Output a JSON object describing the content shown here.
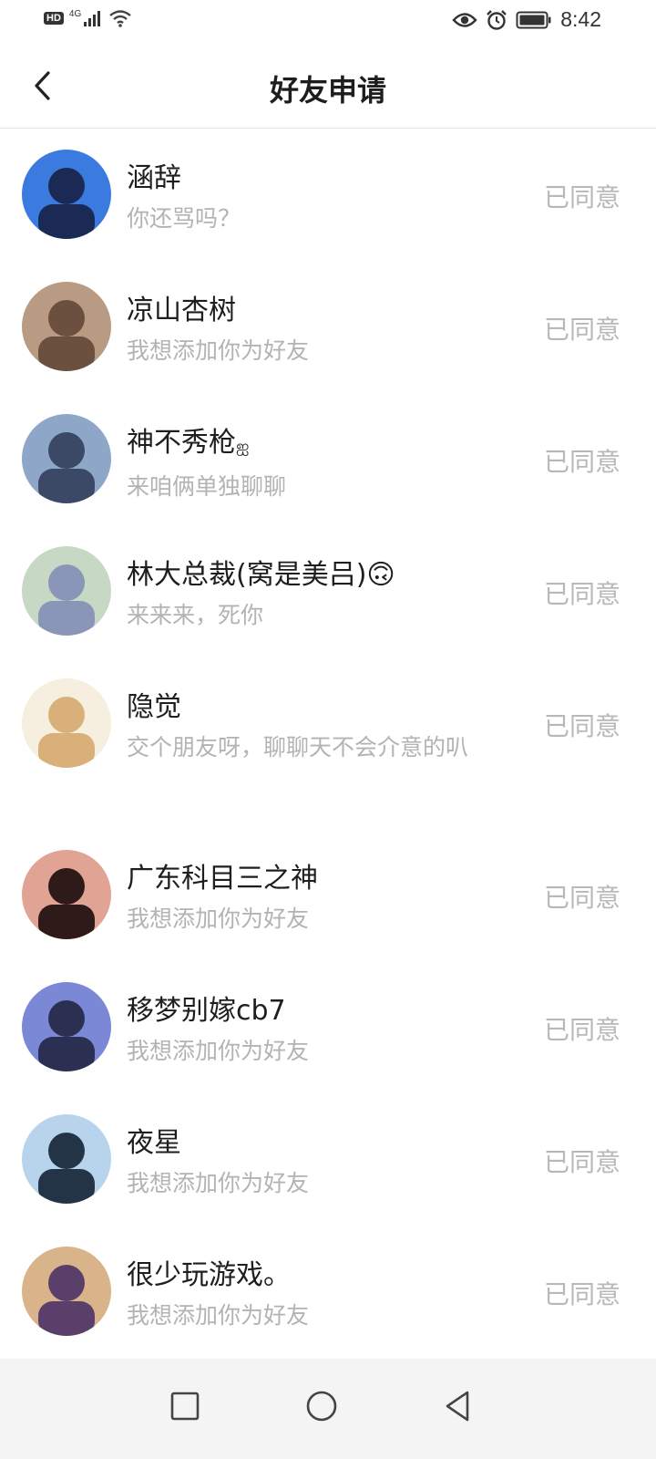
{
  "status_bar": {
    "hd": "HD",
    "network": "4G",
    "time": "8:42"
  },
  "header": {
    "title": "好友申请"
  },
  "requests": [
    {
      "name": "涵辞",
      "message": "你还骂吗？",
      "status": "已同意",
      "avatar_colors": [
        "#3b7be0",
        "#1a2a55"
      ]
    },
    {
      "name": "凉山杏树",
      "message": "我想添加你为好友",
      "status": "已同意",
      "avatar_colors": [
        "#b99a82",
        "#6b4f3f"
      ]
    },
    {
      "name": "神不秀枪",
      "name_suffix": "ஐ",
      "message": "来咱俩单独聊聊",
      "status": "已同意",
      "avatar_colors": [
        "#8ea6c8",
        "#3b4866"
      ]
    },
    {
      "name": "林大总裁(窝是美吕)",
      "name_emoji": "🙃",
      "message": "来来来，死你",
      "status": "已同意",
      "avatar_colors": [
        "#c7d8c4",
        "#8a96b8"
      ]
    },
    {
      "name": "隐觉",
      "message": "交个朋友呀，聊聊天不会介意的叭",
      "status": "已同意",
      "avatar_colors": [
        "#f6eedf",
        "#d9b07a"
      ]
    },
    {
      "name": "广东科目三之神",
      "message": "我想添加你为好友",
      "status": "已同意",
      "avatar_colors": [
        "#e0a394",
        "#2e1a18"
      ]
    },
    {
      "name": "移梦别嫁cb7",
      "message": "我想添加你为好友",
      "status": "已同意",
      "avatar_colors": [
        "#7b88d6",
        "#2b2f52"
      ]
    },
    {
      "name": "夜星",
      "message": "我想添加你为好友",
      "status": "已同意",
      "avatar_colors": [
        "#b8d4ec",
        "#243447"
      ]
    },
    {
      "name": "很少玩游戏。",
      "message": "我想添加你为好友",
      "status": "已同意",
      "avatar_colors": [
        "#d9b48a",
        "#5a3f6b"
      ]
    }
  ]
}
